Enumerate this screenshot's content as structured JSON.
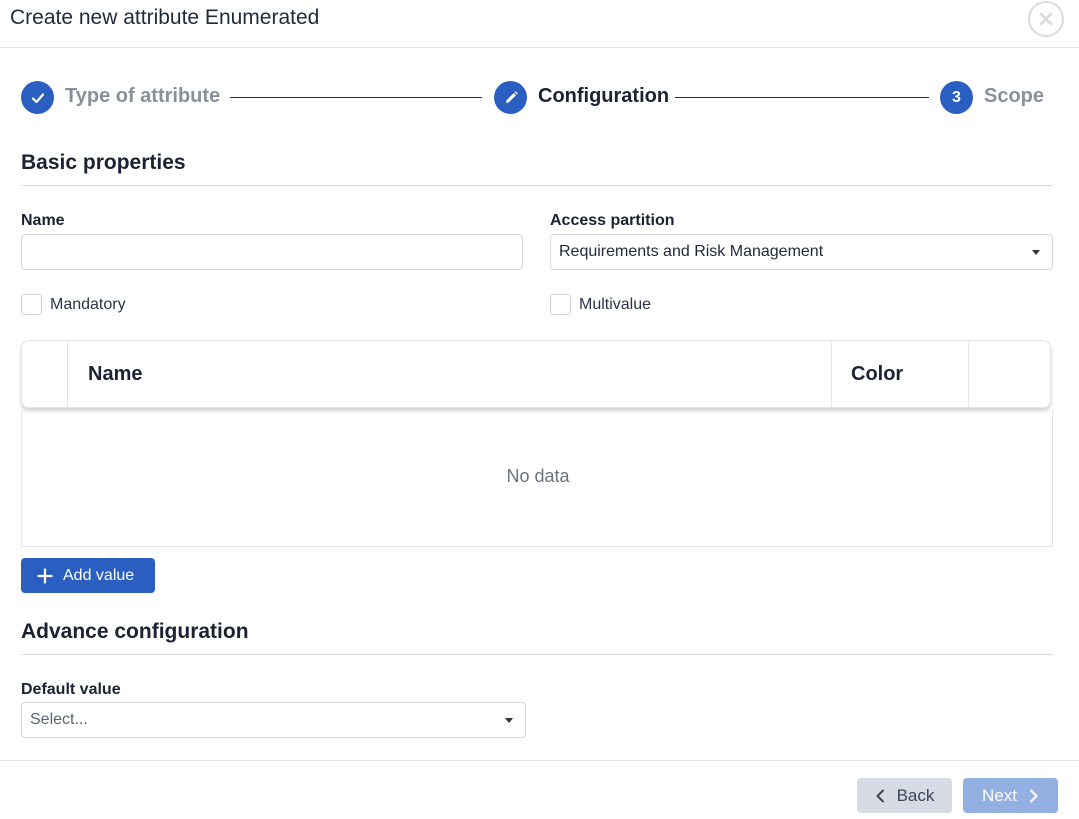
{
  "dialog": {
    "title": "Create new attribute Enumerated",
    "close_icon": "close-circle-icon"
  },
  "stepper": {
    "steps": [
      {
        "label": "Type of attribute",
        "state": "completed",
        "icon": "check-icon"
      },
      {
        "label": "Configuration",
        "state": "active",
        "icon": "pencil-icon"
      },
      {
        "label": "Scope",
        "state": "pending",
        "number": "3"
      }
    ]
  },
  "basic": {
    "title": "Basic properties",
    "name_label": "Name",
    "name_value": "",
    "partition_label": "Access partition",
    "partition_value": "Requirements and Risk Management",
    "mandatory_label": "Mandatory",
    "multivalue_label": "Multivalue"
  },
  "table": {
    "columns": [
      "Name",
      "Color"
    ],
    "empty_text": "No data"
  },
  "add_value_label": "Add value",
  "advance": {
    "title": "Advance configuration",
    "default_label": "Default value",
    "default_placeholder": "Select..."
  },
  "footer": {
    "back_label": "Back",
    "next_label": "Next"
  },
  "colors": {
    "primary": "#2a5fc1",
    "next_disabled": "#93b0e3",
    "back_bg": "#d6dbe5"
  }
}
